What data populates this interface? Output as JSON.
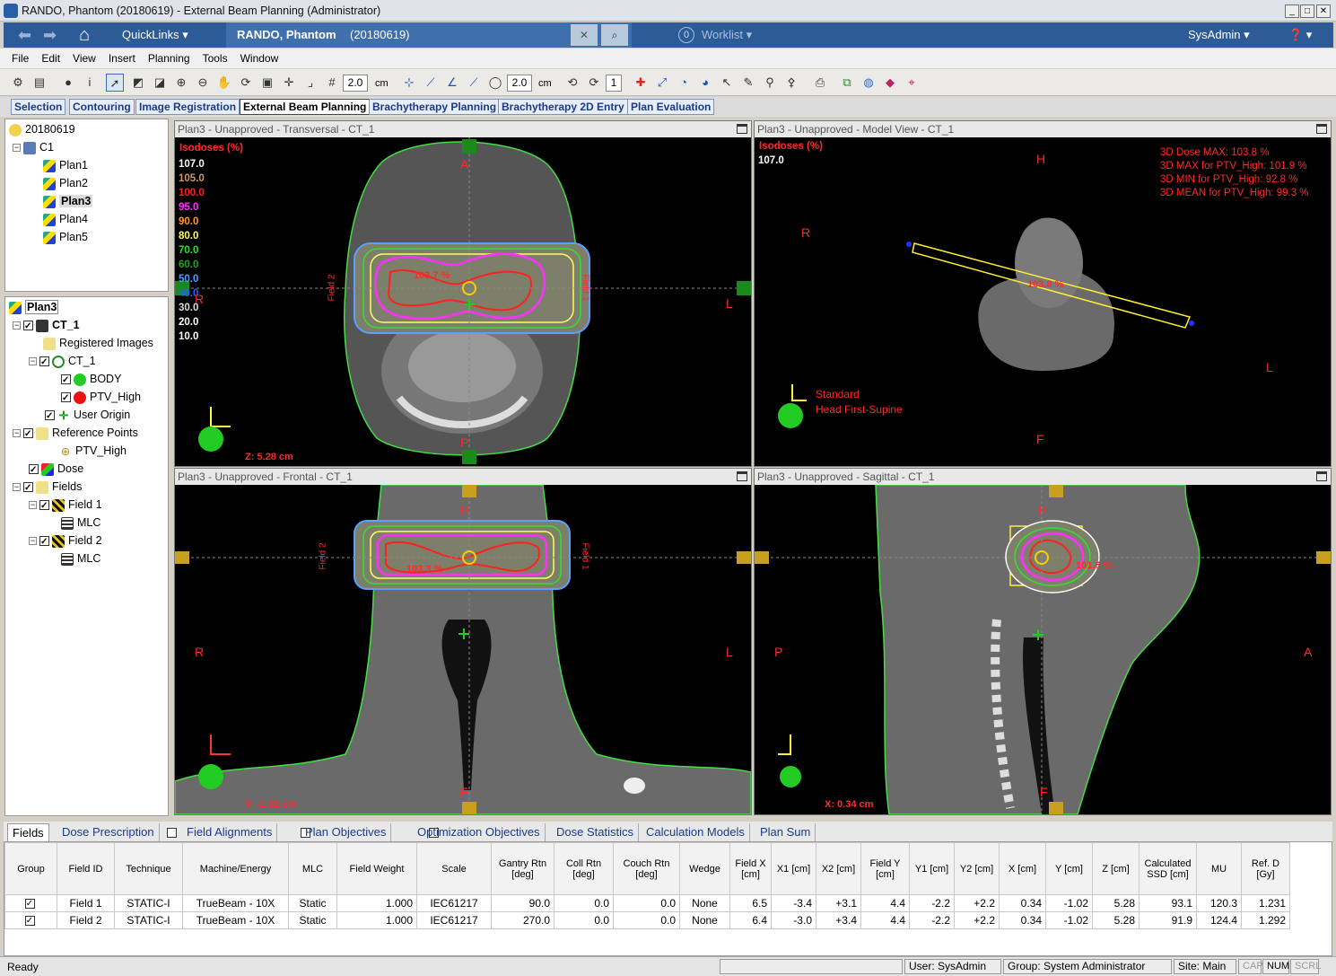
{
  "window": {
    "title": "RANDO, Phantom (20180619) - External Beam Planning (Administrator)",
    "min": "_",
    "max": "□",
    "close": "✕"
  },
  "nav": {
    "quicklinks": "QuickLinks",
    "patient_name": "RANDO, Phantom",
    "patient_id": "(20180619)",
    "worklist_count": "0",
    "worklist": "Worklist",
    "user": "SysAdmin"
  },
  "menu": [
    "File",
    "Edit",
    "View",
    "Insert",
    "Planning",
    "Tools",
    "Window"
  ],
  "toolbar": {
    "zoom_value1": "2.0",
    "unit1": "cm",
    "zoom_value2": "2.0",
    "unit2": "cm",
    "count": "1"
  },
  "workspaces": [
    "Selection",
    "Contouring",
    "Image Registration",
    "External Beam Planning",
    "Brachytherapy Planning",
    "Brachytherapy 2D Entry",
    "Plan Evaluation"
  ],
  "course_tree": {
    "patient": "20180619",
    "course": "C1",
    "plans": [
      "Plan1",
      "Plan2",
      "Plan3",
      "Plan4",
      "Plan5"
    ],
    "selected": "Plan3"
  },
  "plan_tree": {
    "plan": "Plan3",
    "image": "CT_1",
    "registered": "Registered Images",
    "ct_struct": "CT_1",
    "body": "BODY",
    "ptv": "PTV_High",
    "user_origin": "User Origin",
    "ref_points": "Reference Points",
    "ref_ptv": "PTV_High",
    "dose": "Dose",
    "fields": "Fields",
    "field1": "Field 1",
    "mlc1": "MLC",
    "field2": "Field 2",
    "mlc2": "MLC"
  },
  "views": {
    "transversal": {
      "title": "Plan3  -  Unapproved - Transversal - CT_1",
      "isodose_title": "Isodoses (%)",
      "isodoses": [
        "107.0",
        "105.0",
        "100.0",
        "95.0",
        "90.0",
        "80.0",
        "70.0",
        "60.0",
        "50.0",
        "40.0",
        "30.0",
        "20.0",
        "10.0"
      ],
      "iso_colors": [
        "#ffffff",
        "#c99a6a",
        "#ff2020",
        "#ff30ff",
        "#ff9a2a",
        "#ffff60",
        "#30e030",
        "#20a020",
        "#4aa0ff",
        "#2060ff",
        "#dddddd",
        "#ffffff",
        "#ffffff"
      ],
      "A": "A",
      "P": "P",
      "R": "R",
      "L": "L",
      "field1": "Field 1",
      "field2": "Field 2",
      "hotspot": "103.7 %",
      "z": "Z: 5.28 cm"
    },
    "model": {
      "title": "Plan3  -  Unapproved - Model View - CT_1",
      "isodose_title": "Isodoses (%)",
      "iso_top": "107.0",
      "H": "H",
      "F": "F",
      "R": "R",
      "L": "L",
      "stats": [
        "3D Dose MAX: 103.8 %",
        "3D MAX for PTV_High: 101.9 %",
        "3D MIN for PTV_High: 92.8 %",
        "3D MEAN for PTV_High: 99.3 %"
      ],
      "hotspot": "103.8 %",
      "orient1": "Standard",
      "orient2": "Head First-Supine"
    },
    "frontal": {
      "title": "Plan3  -  Unapproved - Frontal - CT_1",
      "H": "H",
      "F": "F",
      "R": "R",
      "L": "L",
      "field1": "Field 1",
      "field2": "Field 2",
      "hotspot": "103.3 %",
      "y": "Y: -1.02 cm"
    },
    "sagittal": {
      "title": "Plan3  -  Unapproved - Sagittal - CT_1",
      "H": "H",
      "F": "F",
      "P": "P",
      "A": "A",
      "hotspot": "101.6 %",
      "x": "X: 0.34 cm"
    }
  },
  "bottom_tabs": [
    "Fields",
    "Dose Prescription",
    "Field Alignments",
    "Plan Objectives",
    "Optimization Objectives",
    "Dose Statistics",
    "Calculation Models",
    "Plan Sum"
  ],
  "fields_table": {
    "headers": [
      "Group",
      "Field ID",
      "Technique",
      "Machine/Energy",
      "MLC",
      "Field Weight",
      "Scale",
      "Gantry Rtn [deg]",
      "Coll Rtn [deg]",
      "Couch Rtn [deg]",
      "Wedge",
      "Field X [cm]",
      "X1 [cm]",
      "X2 [cm]",
      "Field Y [cm]",
      "Y1 [cm]",
      "Y2 [cm]",
      "X [cm]",
      "Y [cm]",
      "Z [cm]",
      "Calculated SSD [cm]",
      "MU",
      "Ref. D [Gy]"
    ],
    "rows": [
      [
        "✓",
        "Field 1",
        "STATIC-I",
        "TrueBeam - 10X",
        "Static",
        "1.000",
        "IEC61217",
        "90.0",
        "0.0",
        "0.0",
        "None",
        "6.5",
        "-3.4",
        "+3.1",
        "4.4",
        "-2.2",
        "+2.2",
        "0.34",
        "-1.02",
        "5.28",
        "93.1",
        "120.3",
        "1.231"
      ],
      [
        "✓",
        "Field 2",
        "STATIC-I",
        "TrueBeam - 10X",
        "Static",
        "1.000",
        "IEC61217",
        "270.0",
        "0.0",
        "0.0",
        "None",
        "6.4",
        "-3.0",
        "+3.4",
        "4.4",
        "-2.2",
        "+2.2",
        "0.34",
        "-1.02",
        "5.28",
        "91.9",
        "124.4",
        "1.292"
      ]
    ]
  },
  "status": {
    "ready": "Ready",
    "user": "User: SysAdmin",
    "group": "Group: System Administrator",
    "site": "Site: Main",
    "cap": "CAP",
    "num": "NUM",
    "scrl": "SCRL"
  }
}
